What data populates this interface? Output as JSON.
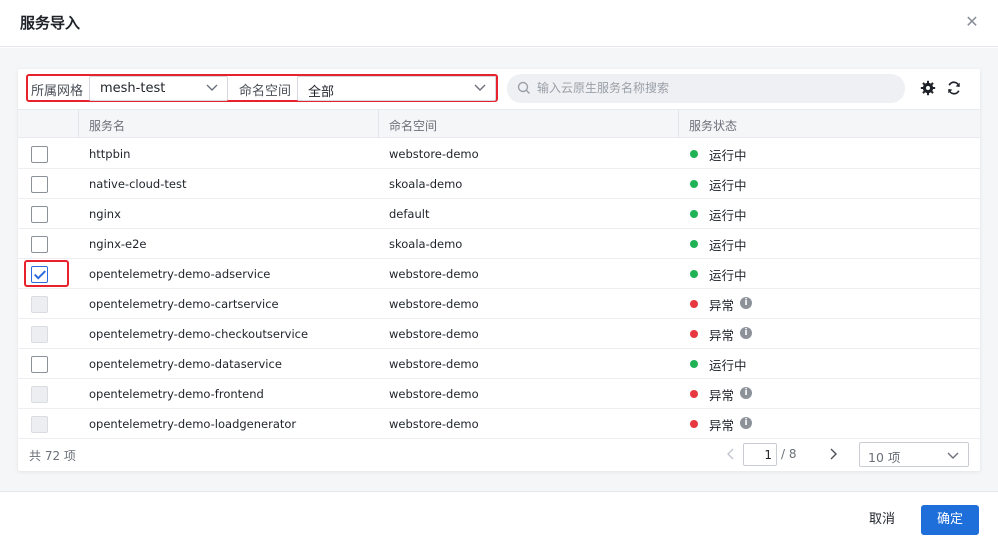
{
  "dialog": {
    "title": "服务导入",
    "close_icon": "close-icon"
  },
  "filter": {
    "mesh_label": "所属网格",
    "mesh_value": "mesh-test",
    "namespace_label": "命名空间",
    "namespace_value": "全部"
  },
  "search": {
    "placeholder": "输入云原生服务名称搜索"
  },
  "toolbar": {
    "settings_icon": "gear-icon",
    "refresh_icon": "refresh-icon"
  },
  "table": {
    "columns": [
      "服务名",
      "命名空间",
      "服务状态"
    ],
    "rows": [
      {
        "name": "httpbin",
        "namespace": "webstore-demo",
        "status": "运行中",
        "status_type": "running",
        "checked": false,
        "disabled": false
      },
      {
        "name": "native-cloud-test",
        "namespace": "skoala-demo",
        "status": "运行中",
        "status_type": "running",
        "checked": false,
        "disabled": false
      },
      {
        "name": "nginx",
        "namespace": "default",
        "status": "运行中",
        "status_type": "running",
        "checked": false,
        "disabled": false
      },
      {
        "name": "nginx-e2e",
        "namespace": "skoala-demo",
        "status": "运行中",
        "status_type": "running",
        "checked": false,
        "disabled": false
      },
      {
        "name": "opentelemetry-demo-adservice",
        "namespace": "webstore-demo",
        "status": "运行中",
        "status_type": "running",
        "checked": true,
        "disabled": false
      },
      {
        "name": "opentelemetry-demo-cartservice",
        "namespace": "webstore-demo",
        "status": "异常",
        "status_type": "error",
        "checked": false,
        "disabled": true
      },
      {
        "name": "opentelemetry-demo-checkoutservice",
        "namespace": "webstore-demo",
        "status": "异常",
        "status_type": "error",
        "checked": false,
        "disabled": true
      },
      {
        "name": "opentelemetry-demo-dataservice",
        "namespace": "webstore-demo",
        "status": "运行中",
        "status_type": "running",
        "checked": false,
        "disabled": false
      },
      {
        "name": "opentelemetry-demo-frontend",
        "namespace": "webstore-demo",
        "status": "异常",
        "status_type": "error",
        "checked": false,
        "disabled": true
      },
      {
        "name": "opentelemetry-demo-loadgenerator",
        "namespace": "webstore-demo",
        "status": "异常",
        "status_type": "error",
        "checked": false,
        "disabled": true
      }
    ]
  },
  "pagination": {
    "total": "共 72 项",
    "current": "1",
    "pages": "/ 8",
    "page_size": "10 项"
  },
  "footer": {
    "cancel": "取消",
    "confirm": "确定"
  },
  "colors": {
    "running": "#1fb356",
    "error": "#e8383f",
    "primary": "#1e6fd9",
    "highlight": "#e8222c"
  }
}
